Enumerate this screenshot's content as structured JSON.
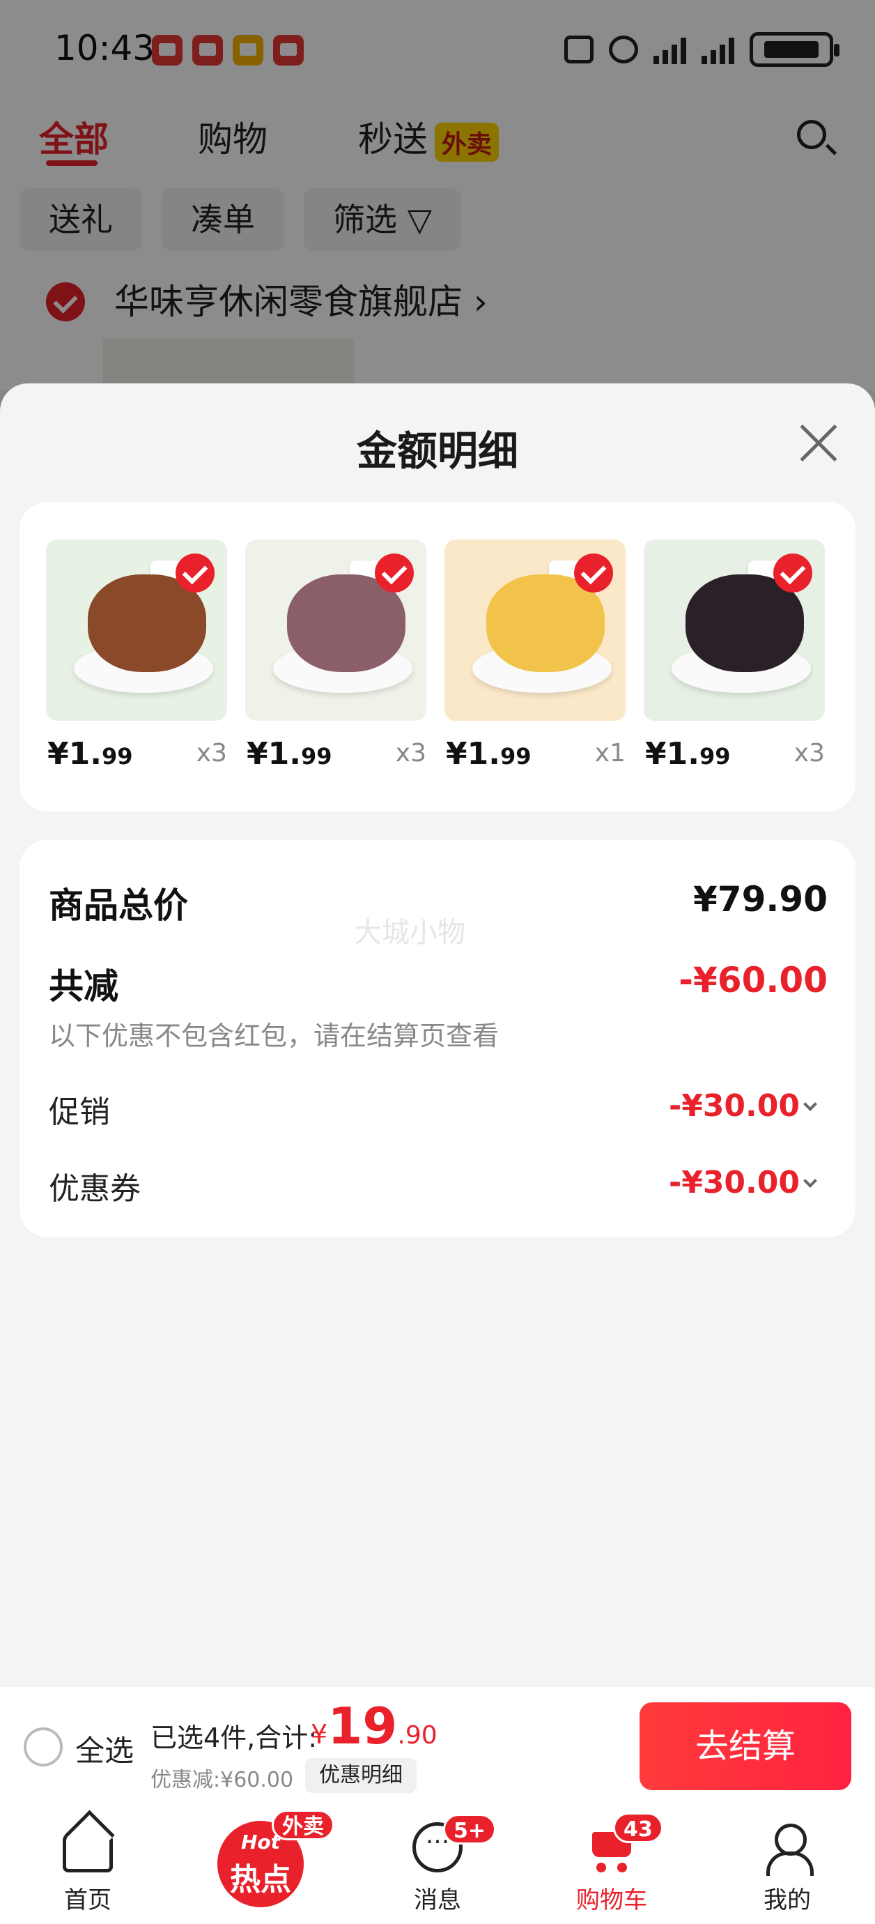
{
  "status_bar": {
    "time": "10:43"
  },
  "top_tabs": [
    {
      "label": "全部",
      "active": true
    },
    {
      "label": "购物",
      "active": false
    },
    {
      "label": "秒送",
      "active": false,
      "tag": "外卖"
    }
  ],
  "filters": [
    "送礼",
    "凑单",
    "筛选"
  ],
  "store": {
    "name": "华味亨休闲零食旗舰店"
  },
  "sheet": {
    "title": "金额明细",
    "products": [
      {
        "price_main": "¥1.",
        "price_cents": "99",
        "qty": "x3",
        "color": "#8a4a2a"
      },
      {
        "price_main": "¥1.",
        "price_cents": "99",
        "qty": "x3",
        "color": "#8a5f6a"
      },
      {
        "price_main": "¥1.",
        "price_cents": "99",
        "qty": "x1",
        "color": "#f2c34a"
      },
      {
        "price_main": "¥1.",
        "price_cents": "99",
        "qty": "x3",
        "color": "#2a2028"
      }
    ],
    "watermark": "大城小物",
    "summary": {
      "total_label": "商品总价",
      "total_value": "¥79.90",
      "discount_label": "共减",
      "discount_value": "-¥60.00",
      "note": "以下优惠不包含红包，请在结算页查看",
      "rows": [
        {
          "label": "促销",
          "value": "-¥30.00"
        },
        {
          "label": "优惠券",
          "value": "-¥30.00"
        }
      ]
    }
  },
  "checkout": {
    "select_all": "全选",
    "selected_text": "已选4件,合计:",
    "currency": "¥",
    "total_int": "19",
    "total_dec": ".90",
    "discount_text": "优惠减:¥60.00",
    "detail_button": "优惠明细",
    "pay_button": "去结算"
  },
  "bottom_nav": {
    "items": [
      {
        "label": "首页",
        "icon": "home-icon"
      },
      {
        "label": "",
        "icon": "hot-topics-icon",
        "logo_en": "Hot",
        "logo_cn": "热点",
        "badge": "外卖"
      },
      {
        "label": "消息",
        "icon": "message-icon",
        "badge": "5+"
      },
      {
        "label": "购物车",
        "icon": "cart-icon",
        "badge": "43",
        "active": true
      },
      {
        "label": "我的",
        "icon": "profile-icon"
      }
    ]
  },
  "colors": {
    "accent": "#e8212b",
    "background": "#f4f4f4"
  }
}
